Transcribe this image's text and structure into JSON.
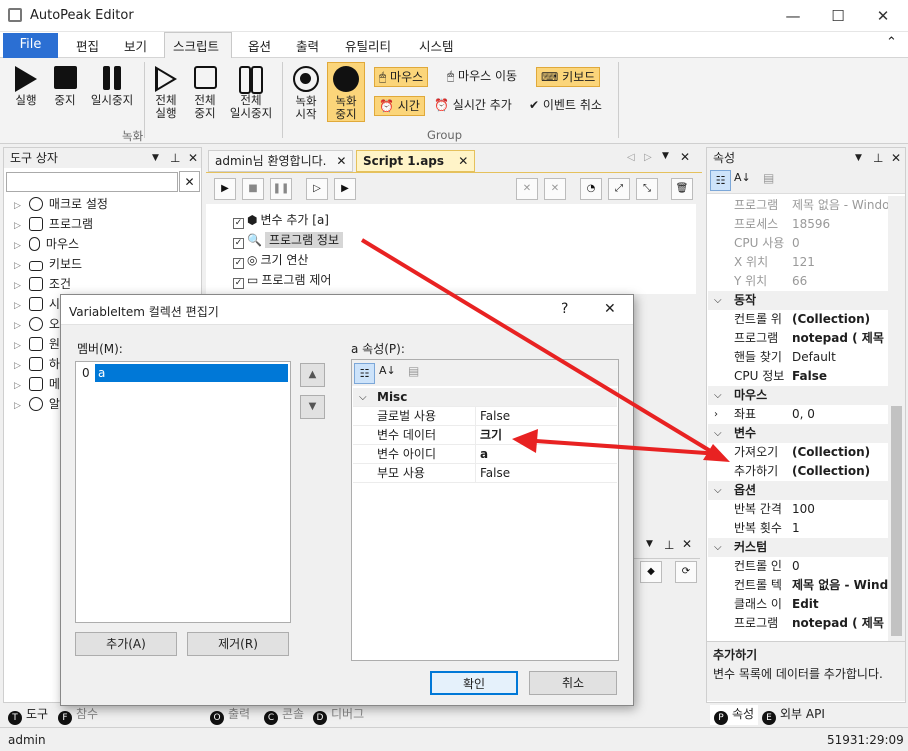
{
  "window": {
    "title": "AutoPeak Editor",
    "min": "—",
    "max": "☐",
    "close": "✕"
  },
  "menu": {
    "file": "File",
    "items": [
      "편집",
      "보기",
      "스크립트",
      "옵션",
      "출력",
      "유틸리티",
      "시스템"
    ],
    "collapse": "⌃"
  },
  "ribbon": {
    "run": "실행",
    "stop": "중지",
    "pause": "일시중지",
    "all_run": [
      "전체",
      "실행"
    ],
    "all_stop": [
      "전체",
      "중지"
    ],
    "all_pause": [
      "전체",
      "일시중지"
    ],
    "rec_start": [
      "녹화",
      "시작"
    ],
    "rec_stop": [
      "녹화",
      "중지"
    ],
    "mouse": "마우스",
    "mouse_move": "마우스 이동",
    "keyboard": "키보드",
    "time": "시간",
    "realtime_add": "실시간 추가",
    "event_cancel": "이벤트 취소",
    "group_record": "녹화",
    "group_group": "Group"
  },
  "toolbox": {
    "title": "도구 상자",
    "search_clear": "✕",
    "items": [
      "매크로 설정",
      "프로그램",
      "마우스",
      "키보드",
      "조건",
      "시",
      "오",
      "원",
      "하",
      "메",
      "알"
    ]
  },
  "editor": {
    "tab_welcome": "admin님 환영합니다.",
    "tab_script": "Script 1.aps",
    "rows": [
      "변수 추가 [a]",
      "프로그램 정보",
      "크기 연산",
      "프로그램 제어"
    ]
  },
  "properties": {
    "title": "속성",
    "rows_top": [
      {
        "n": "프로그램",
        "v": "제목 없음 - Windo"
      },
      {
        "n": "프로세스",
        "v": "18596"
      },
      {
        "n": "CPU 사용",
        "v": "0"
      },
      {
        "n": "X 위치",
        "v": "121"
      },
      {
        "n": "Y 위치",
        "v": "66"
      }
    ],
    "cat_action": "동작",
    "rows_action": [
      {
        "n": "컨트롤 위",
        "v": "(Collection)"
      },
      {
        "n": "프로그램",
        "v": "notepad ( 제목 없"
      },
      {
        "n": "핸들 찾기",
        "v": "Default"
      },
      {
        "n": "CPU 정보",
        "v": "False"
      }
    ],
    "cat_mouse": "마우스",
    "rows_mouse": [
      {
        "n": "좌표",
        "v": "0, 0"
      }
    ],
    "cat_var": "변수",
    "rows_var": [
      {
        "n": "가져오기",
        "v": "(Collection)"
      },
      {
        "n": "추가하기",
        "v": "(Collection)"
      }
    ],
    "cat_option": "옵션",
    "rows_option": [
      {
        "n": "반복 간격",
        "v": "100"
      },
      {
        "n": "반복 횟수",
        "v": "1"
      }
    ],
    "cat_custom": "커스텀",
    "rows_custom": [
      {
        "n": "컨트롤 인",
        "v": "0"
      },
      {
        "n": "컨트롤 텍",
        "v": "제목 없음 - Wind"
      },
      {
        "n": "클래스 이",
        "v": "Edit"
      },
      {
        "n": "프로그램",
        "v": "notepad ( 제목 없"
      }
    ],
    "desc_title": "추가하기",
    "desc_text": "변수 목록에 데이터를 추가합니다."
  },
  "dialog": {
    "title": "VariableItem 컬렉션 편집기",
    "help": "?",
    "close": "✕",
    "members_label": "멤버(M):",
    "member_index": "0",
    "member_name": "a",
    "props_label": "a 속성(P):",
    "category": "Misc",
    "rows": [
      {
        "n": "글로벌 사용",
        "v": "False"
      },
      {
        "n": "변수 데이터",
        "v": "크기"
      },
      {
        "n": "변수 아이디",
        "v": "a"
      },
      {
        "n": "부모 사용",
        "v": "False"
      }
    ],
    "add": "추가(A)",
    "remove": "제거(R)",
    "ok": "확인",
    "cancel": "취소"
  },
  "bottom_tabs": {
    "tool": "도구",
    "t2": "참수",
    "b1": "출력",
    "b2": "콘솔",
    "b3": "디버그",
    "prop": "속성",
    "api": "외부 API"
  },
  "status": {
    "user": "admin",
    "time": "51931:29:09"
  },
  "colors": {
    "accent": "#2b6fd3",
    "highlight": "#fbd57a",
    "arrow": "#e82222"
  }
}
